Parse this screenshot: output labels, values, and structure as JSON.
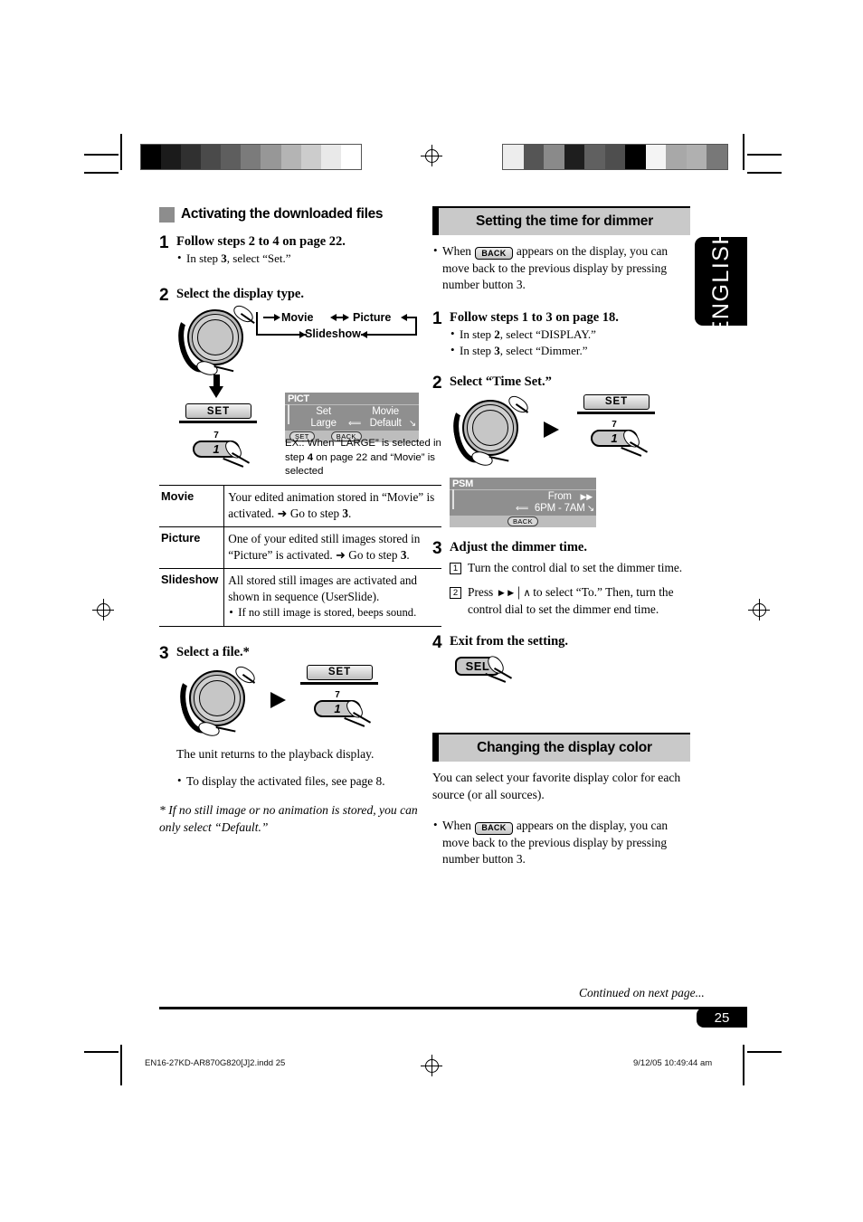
{
  "page": {
    "language_tab": "ENGLISH",
    "page_number": "25",
    "continued": "Continued on next page...",
    "footer_file": "EN16-27KD-AR870G820[J]2.indd   25",
    "footer_date": "9/12/05   10:49:44 am"
  },
  "colors": {
    "heading_bar": "#c9c9c9",
    "square_bullet": "#8d8d8d",
    "lcd_background": "#8f8f8f",
    "lcd_footer": "#bdbdbd",
    "tab_background": "#000000"
  },
  "grayscale_bar_left": [
    "#000000",
    "#1b1b1b",
    "#303030",
    "#4a4a4a",
    "#5e5e5e",
    "#7b7b7b",
    "#979797",
    "#b4b4b4",
    "#cccccc",
    "#e9e9e9",
    "#ffffff"
  ],
  "grayscale_bar_right": [
    "#ededed",
    "#555555",
    "#8a8a8a",
    "#1e1e1e",
    "#606060",
    "#4e4e4e",
    "#000000",
    "#f4f4f4",
    "#a8a8a8",
    "#b0b0b0",
    "#787878"
  ],
  "left_column": {
    "heading": "Activating the downloaded files",
    "step1": {
      "number": "1",
      "title_parts": [
        "Follow steps ",
        "2",
        " to ",
        "4",
        " on page 22."
      ],
      "bullets": [
        [
          "In step ",
          "3",
          ", select “Set.”"
        ]
      ]
    },
    "step2": {
      "number": "2",
      "title": "Select the display type.",
      "flow": {
        "movie": "Movie",
        "picture": "Picture",
        "slideshow": "Slideshow"
      },
      "set_button": "SET",
      "number_button": "1",
      "number_button_label": "7",
      "lcd": {
        "header": "PICT",
        "row1_left": "Set",
        "row1_right": "Movie",
        "row2_left": "Large",
        "row2_right": "Default",
        "footer_set": "SET",
        "footer_back": "BACK"
      },
      "example_label": "EX.:",
      "example_parts": [
        "When “LARGE” is selected in step ",
        "4",
        " on page 22 and “Movie” is selected"
      ]
    },
    "table": {
      "rows": [
        {
          "key": "Movie",
          "text_parts": [
            "Your edited animation stored in “Movie” is activated. ",
            "➜",
            " Go to step ",
            "3",
            "."
          ]
        },
        {
          "key": "Picture",
          "text_parts": [
            "One of your edited still images stored in “Picture” is activated. ",
            "➜",
            " Go to step ",
            "3",
            "."
          ]
        },
        {
          "key": "Slideshow",
          "text_parts": [
            "All stored still images are activated and shown in sequence (UserSlide).",
            "",
            "",
            "",
            ""
          ],
          "bullets": [
            "If no still image is stored, beeps sound."
          ]
        }
      ]
    },
    "step3": {
      "number": "3",
      "title": "Select a file.*",
      "set_button": "SET",
      "number_button": "1",
      "number_button_label": "7",
      "result": "The unit returns to the playback display.",
      "bullets": [
        "To display the activated files, see page 8."
      ],
      "footnote": "* If no still image or no animation is stored, you can only select “Default.”"
    }
  },
  "right_column": {
    "section1": {
      "heading": "Setting the time for dimmer",
      "note_parts": [
        "When ",
        "BACK",
        " appears on the display, you can move back to the previous display by pressing number button 3."
      ],
      "step1": {
        "number": "1",
        "title_parts": [
          "Follow steps ",
          "1",
          " to ",
          "3",
          " on page 18."
        ],
        "bullets": [
          [
            "In step ",
            "2",
            ", select “DISPLAY.”"
          ],
          [
            "In step ",
            "3",
            ", select “Dimmer.”"
          ]
        ]
      },
      "step2": {
        "number": "2",
        "title": "Select “Time Set.”",
        "set_button": "SET",
        "number_button": "1",
        "number_button_label": "7",
        "lcd": {
          "header": "PSM",
          "row1_right": "From",
          "row2_right": "6PM - 7AM",
          "footer_back": "BACK"
        }
      },
      "step3": {
        "number": "3",
        "title": "Adjust the dimmer time.",
        "substeps": [
          {
            "num": "1",
            "text": "Turn the control dial to set the dimmer time."
          },
          {
            "num": "2",
            "text_before": "Press ",
            "icons": "►►│ ∧",
            "text_after": " to select “To.” Then, turn the control dial to set the dimmer end time."
          }
        ]
      },
      "step4": {
        "number": "4",
        "title": "Exit from the setting.",
        "sel_button": "SEL"
      }
    },
    "section2": {
      "heading": "Changing the display color",
      "intro": "You can select your favorite display color for each source (or all sources).",
      "note_parts": [
        "When ",
        "BACK",
        " appears on the display, you can move back to the previous display by pressing number button 3."
      ]
    }
  }
}
